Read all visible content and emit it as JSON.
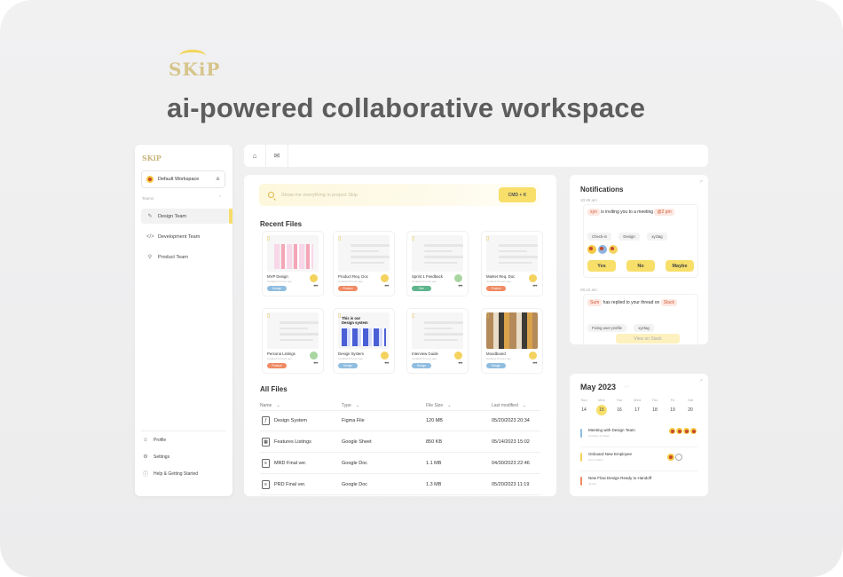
{
  "hero": {
    "logo": "SKiP",
    "headline": "ai-powered collaborative workspace"
  },
  "sidebar": {
    "logo": "SKiP",
    "workspace": "Default Workspace",
    "teams_label": "Teams",
    "items": [
      {
        "label": "Design Team",
        "icon": "pen-icon",
        "active": true
      },
      {
        "label": "Development Team",
        "icon": "code-icon",
        "active": false
      },
      {
        "label": "Product Team",
        "icon": "box-icon",
        "active": false
      }
    ],
    "bottom": [
      {
        "label": "Profile",
        "icon": "user-icon"
      },
      {
        "label": "Settings",
        "icon": "gear-icon"
      },
      {
        "label": "Help & Getting Started",
        "icon": "help-icon"
      }
    ]
  },
  "tabs": [
    {
      "icon": "home-icon",
      "glyph": "⌂"
    },
    {
      "icon": "inbox-icon",
      "glyph": "✉"
    }
  ],
  "search": {
    "placeholder": "Show me everything in project Skip",
    "shortcut": "CMD + K"
  },
  "recent_files": {
    "title": "Recent Files",
    "items": [
      {
        "name": "MVP Design",
        "sub": "Updated 8 hours ago",
        "tag": "Design",
        "tag_color": "#8fbde0",
        "thumb": "design"
      },
      {
        "name": "Product Req. Doc",
        "sub": "Updated 8 hours ago",
        "tag": "Product",
        "tag_color": "#ef8a62",
        "thumb": "doc"
      },
      {
        "name": "Sprint 1 Feedback",
        "sub": "Updated 8 hours ago",
        "tag": "Dev",
        "tag_color": "#5fb58c",
        "thumb": "doc"
      },
      {
        "name": "Market Req. Doc",
        "sub": "Updated 8 hours ago",
        "tag": "Product",
        "tag_color": "#ef8a62",
        "thumb": "doc"
      },
      {
        "name": "Persona Listings",
        "sub": "Updated 8 hours ago",
        "tag": "Product",
        "tag_color": "#ef8a62",
        "thumb": "doc"
      },
      {
        "name": "Design System",
        "sub": "Updated 8 hours ago",
        "tag": "Design",
        "tag_color": "#8fbde0",
        "thumb": "system",
        "thumb_text": "This is our Design system"
      },
      {
        "name": "Interview Guide",
        "sub": "Updated 8 hours ago",
        "tag": "Design",
        "tag_color": "#8fbde0",
        "thumb": "doc"
      },
      {
        "name": "Moodboard",
        "sub": "Updated 8 hours ago",
        "tag": "Design",
        "tag_color": "#8fbde0",
        "thumb": "mood"
      }
    ]
  },
  "all_files": {
    "title": "All Files",
    "columns": [
      "Name",
      "Type",
      "File Size",
      "Last modified"
    ],
    "rows": [
      {
        "name": "Design System",
        "type": "Figma File",
        "size": "120 MB",
        "modified": "05/20/2023 20:34",
        "icon": "figma-icon"
      },
      {
        "name": "Features Listings",
        "type": "Google Sheet",
        "size": "850 KB",
        "modified": "05/14/2023 15:02",
        "icon": "sheet-icon"
      },
      {
        "name": "MRD Final ver.",
        "type": "Google Doc",
        "size": "1.1 MB",
        "modified": "04/30/2023 22:46",
        "icon": "doc-icon"
      },
      {
        "name": "PRD Final ver.",
        "type": "Google Doc",
        "size": "1.3 MB",
        "modified": "05/20/2023 11:19",
        "icon": "doc-icon"
      }
    ]
  },
  "notifications": {
    "title": "Notifications",
    "items": [
      {
        "time": "10:45 am",
        "name": "xyn",
        "text": "is inviting you to a meeting",
        "meeting_time": "@2 pm",
        "chips": [
          "Check-in",
          "Design",
          "xyztag"
        ],
        "buttons": [
          "Yes",
          "No",
          "Maybe"
        ]
      },
      {
        "time": "09:10 am",
        "name": "Sum",
        "text": "has replied to your thread on",
        "channel": "Slack",
        "chips": [
          "Fixing user profile",
          "xyztag"
        ],
        "link": "View on Slack"
      }
    ]
  },
  "calendar": {
    "title": "May 2023",
    "nav": "‹  ›",
    "days": [
      "Sun",
      "Mon",
      "Tue",
      "Wed",
      "Thu",
      "Fri",
      "Sat"
    ],
    "dates": [
      "14",
      "15",
      "16",
      "17",
      "18",
      "19",
      "20"
    ],
    "today_index": 1,
    "events": [
      {
        "title": "Meeting with Design Team",
        "sub": "10:00am-11:30am",
        "color": "#8fbde0"
      },
      {
        "title": "Onboard New Employee",
        "sub": "1pm-4:30pm",
        "color": "#f3d25e"
      },
      {
        "title": "New Flow Design Ready to Handoff",
        "sub": "All day",
        "color": "#ef8a62"
      }
    ]
  },
  "colors": {
    "accent": "#f7df6a",
    "bg": "#f1f1f2",
    "text": "#333333"
  }
}
